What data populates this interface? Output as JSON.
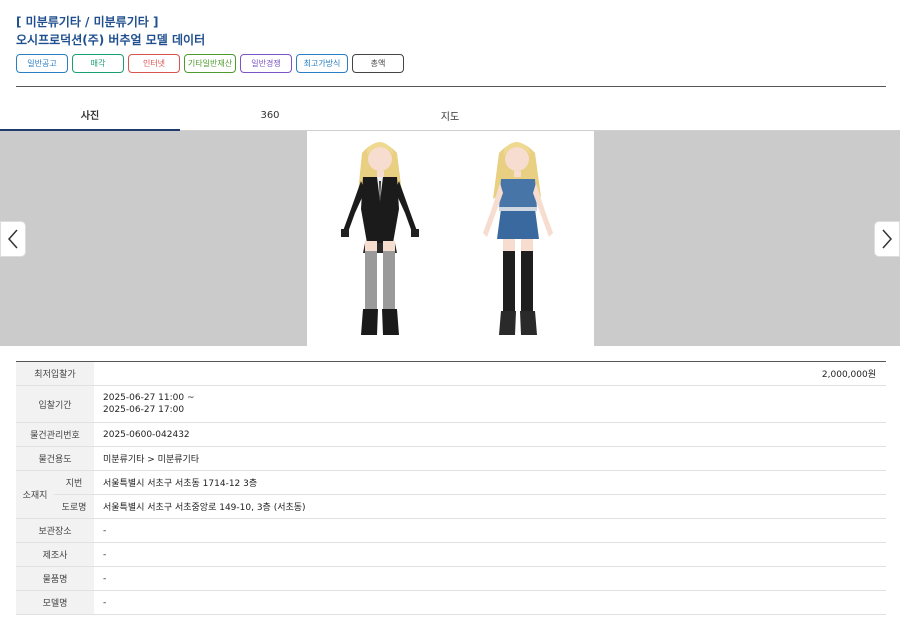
{
  "header": {
    "category": "[ 미분류기타 / 미분류기타 ]",
    "title": "오시프로덕션(주) 버추얼 모델 데이터",
    "tags": [
      {
        "label": "일반공고",
        "color": "#2a7fc4",
        "width": 50
      },
      {
        "label": "매각",
        "color": "#1a9e74",
        "width": 50
      },
      {
        "label": "인터넷",
        "color": "#d9534f",
        "width": 50
      },
      {
        "label": "기타일반재산",
        "color": "#4d9b2e",
        "width": 50
      },
      {
        "label": "일반경쟁",
        "color": "#7b55c6",
        "width": 50
      },
      {
        "label": "최고가방식",
        "color": "#2a7fc4",
        "width": 50
      },
      {
        "label": "총액",
        "color": "#444444",
        "width": 50
      }
    ]
  },
  "tabs": [
    {
      "label": "사진",
      "active": true
    },
    {
      "label": "360",
      "active": false
    },
    {
      "label": "지도",
      "active": false
    }
  ],
  "gallery": {
    "prev_icon": "chevron-left-icon",
    "next_icon": "chevron-right-icon"
  },
  "details": {
    "min_bid_label": "최저입찰가",
    "min_bid_value": "2,000,000원",
    "period_label": "입찰기간",
    "period_start": "2025-06-27 11:00 ~",
    "period_end": "2025-06-27 17:00",
    "item_no_label": "물건관리번호",
    "item_no_value": "2025-0600-042432",
    "usage_label": "물건용도",
    "usage_value": "미분류기타 > 미분류기타",
    "location_label": "소재지",
    "lot_label": "지번",
    "lot_value": "서울특별시 서초구 서초동 1714-12 3층",
    "road_label": "도로명",
    "road_value": "서울특별시 서초구 서초중앙로 149-10, 3층 (서초동)",
    "storage_label": "보관장소",
    "storage_value": "-",
    "maker_label": "제조사",
    "maker_value": "-",
    "product_label": "물품명",
    "product_value": "-",
    "model_label": "모델명",
    "model_value": "-"
  }
}
